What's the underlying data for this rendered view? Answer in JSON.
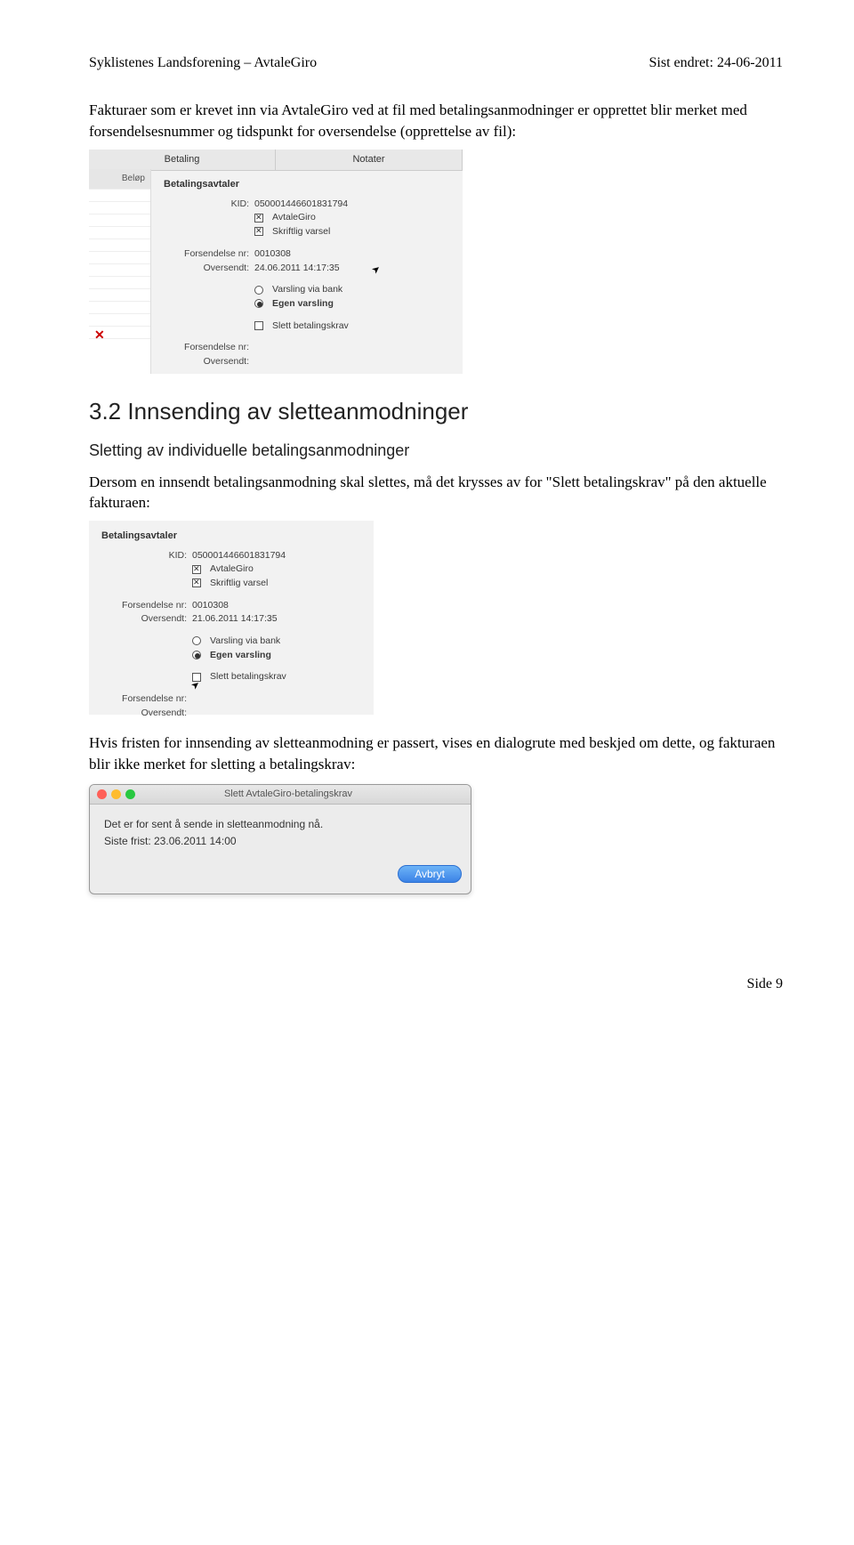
{
  "header": {
    "left": "Syklistenes Landsforening – AvtaleGiro",
    "right": "Sist endret: 24-06-2011"
  },
  "p1": "Fakturaer som er krevet inn via AvtaleGiro ved at fil med betalingsanmodninger er opprettet blir merket med forsendelsesnummer og tidspunkt for oversendelse (opprettelse av fil):",
  "panel1": {
    "tab_betaling": "Betaling",
    "tab_notater": "Notater",
    "side_label": "Beløp",
    "section_title": "Betalingsavtaler",
    "kid_label": "KID:",
    "kid_value": "050001446601831794",
    "avtalegiro_label": "AvtaleGiro",
    "skriftlig_label": "Skriftlig varsel",
    "forsendelse_label": "Forsendelse nr:",
    "forsendelse_value": "0010308",
    "oversendt_label": "Oversendt:",
    "oversendt_value": "24.06.2011 14:17:35",
    "varsling_bank": "Varsling via bank",
    "egen_varsling": "Egen varsling",
    "slett_label": "Slett betalingskrav",
    "forsendelse2_label": "Forsendelse nr:",
    "oversendt2_label": "Oversendt:"
  },
  "h2": "3.2 Innsending av sletteanmodninger",
  "h3": "Sletting av individuelle betalingsanmodninger",
  "p2": "Dersom en innsendt betalingsanmodning skal slettes, må det krysses av for \"Slett betalingskrav\" på den aktuelle fakturaen:",
  "panel2": {
    "section_title": "Betalingsavtaler",
    "kid_label": "KID:",
    "kid_value": "050001446601831794",
    "avtalegiro_label": "AvtaleGiro",
    "skriftlig_label": "Skriftlig varsel",
    "forsendelse_label": "Forsendelse nr:",
    "forsendelse_value": "0010308",
    "oversendt_label": "Oversendt:",
    "oversendt_value": "21.06.2011 14:17:35",
    "varsling_bank": "Varsling via bank",
    "egen_varsling": "Egen varsling",
    "slett_label": "Slett betalingskrav",
    "forsendelse2_label": "Forsendelse nr:",
    "oversendt2_label": "Oversendt:"
  },
  "p3": "Hvis fristen for innsending av sletteanmodning er passert, vises en dialogrute med beskjed om dette, og fakturaen blir ikke merket for sletting a betalingskrav:",
  "dialog": {
    "title": "Slett AvtaleGiro-betalingskrav",
    "line1": "Det er for sent å sende in sletteanmodning nå.",
    "line2": "Siste frist: 23.06.2011 14:00",
    "button": "Avbryt"
  },
  "footer": "Side 9"
}
